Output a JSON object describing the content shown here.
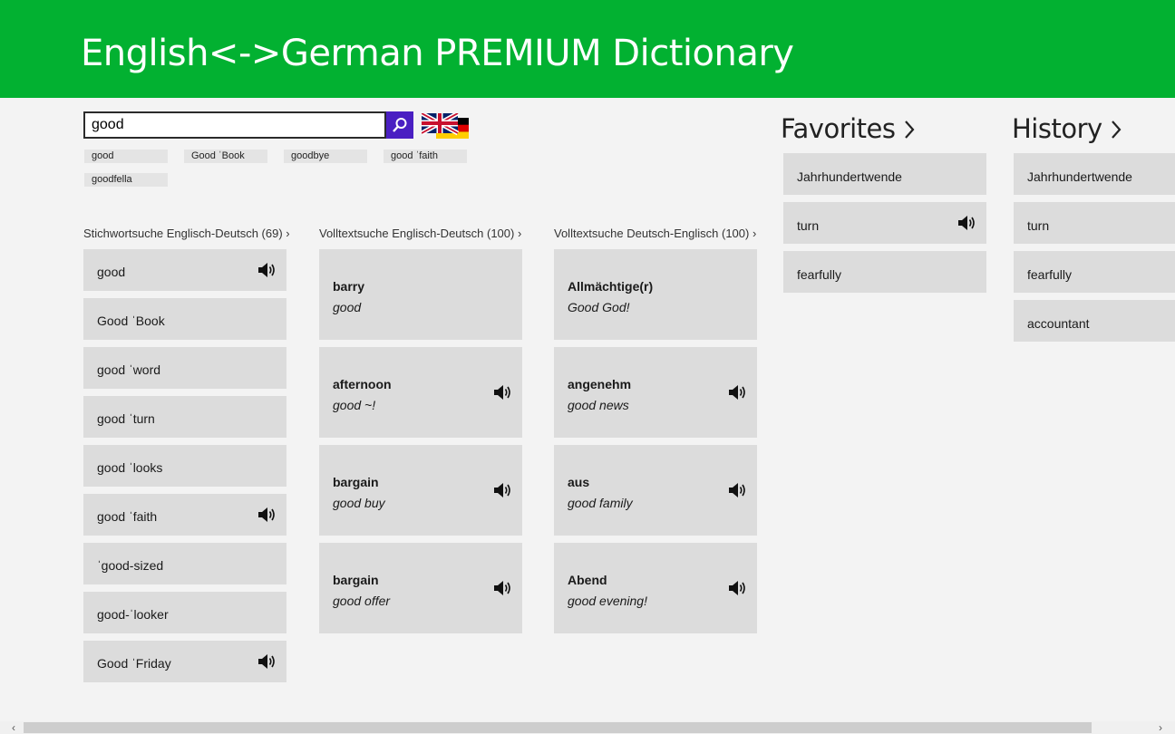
{
  "app": {
    "title": "English<->German PREMIUM Dictionary"
  },
  "search": {
    "value": "good",
    "button_icon": "magnifier-icon",
    "lang_toggle_icon": "uk-de-flag-icon"
  },
  "suggestions": [
    "good",
    "Good ˈBook",
    "goodbye",
    "good ˈfaith",
    "goodfella"
  ],
  "sections": {
    "keyword": {
      "title": "Stichwortsuche Englisch-Deutsch (69)",
      "items": [
        {
          "label": "good",
          "audio": true
        },
        {
          "label": "Good ˈBook",
          "audio": false
        },
        {
          "label": "good ˈword",
          "audio": false
        },
        {
          "label": "good ˈturn",
          "audio": false
        },
        {
          "label": "good ˈlooks",
          "audio": false
        },
        {
          "label": "good ˈfaith",
          "audio": true
        },
        {
          "label": "ˈgood-sized",
          "audio": false
        },
        {
          "label": "good-ˈlooker",
          "audio": false
        },
        {
          "label": "Good ˈFriday",
          "audio": true
        }
      ]
    },
    "fulltext_en_de": {
      "title": "Volltextsuche Englisch-Deutsch (100)",
      "items": [
        {
          "word": "barry",
          "translation": "good",
          "audio": false
        },
        {
          "word": "afternoon",
          "translation": "good ~!",
          "audio": true
        },
        {
          "word": "bargain",
          "translation": "good buy",
          "audio": true
        },
        {
          "word": "bargain",
          "translation": "good offer",
          "audio": true
        }
      ]
    },
    "fulltext_de_en": {
      "title": "Volltextsuche Deutsch-Englisch (100)",
      "items": [
        {
          "word": "Allmächtige(r)",
          "translation": "Good God!",
          "audio": false
        },
        {
          "word": "angenehm",
          "translation": "good news",
          "audio": true
        },
        {
          "word": "aus",
          "translation": "good family",
          "audio": true
        },
        {
          "word": "Abend",
          "translation": "good evening!",
          "audio": true
        }
      ]
    }
  },
  "favorites": {
    "title": "Favorites",
    "items": [
      {
        "label": "Jahrhundertwende",
        "audio": false
      },
      {
        "label": "turn",
        "audio": true
      },
      {
        "label": "fearfully",
        "audio": false
      }
    ]
  },
  "history": {
    "title": "History",
    "items": [
      {
        "label": "Jahrhundertwende"
      },
      {
        "label": "turn"
      },
      {
        "label": "fearfully"
      },
      {
        "label": "accountant"
      }
    ]
  },
  "colors": {
    "header": "#02b131",
    "search_button": "#4a1fc2",
    "tile": "#dcdcdc",
    "background": "#f3f3f3"
  }
}
